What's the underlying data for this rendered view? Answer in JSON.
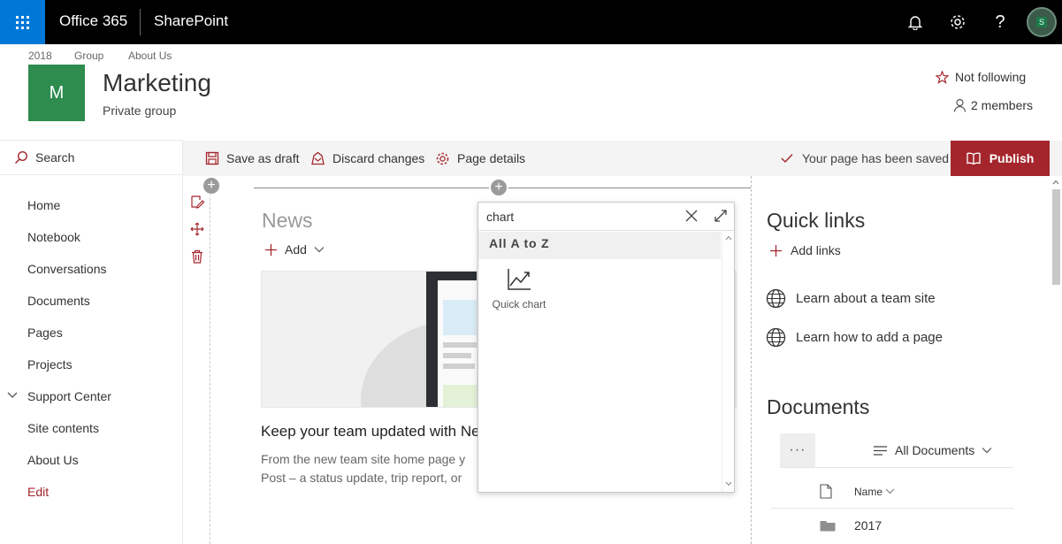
{
  "suite": {
    "app_launcher_icon": "waffle-icon",
    "brand": "Office 365",
    "app": "SharePoint",
    "avatar_text": "S"
  },
  "header": {
    "breadcrumbs": [
      "2018",
      "Group",
      "About Us"
    ],
    "logo_letter": "M",
    "logo_color": "#2d8c4e",
    "title": "Marketing",
    "subtitle": "Private group",
    "follow_label": "Not following",
    "members_label": "2 members"
  },
  "leftnav": {
    "search_label": "Search",
    "items": [
      "Home",
      "Notebook",
      "Conversations",
      "Documents",
      "Pages",
      "Projects",
      "Support Center",
      "Site contents",
      "About Us"
    ],
    "edit_label": "Edit"
  },
  "commandbar": {
    "save_draft": "Save as draft",
    "discard": "Discard changes",
    "page_details": "Page details",
    "saved_status": "Your page has been saved",
    "publish": "Publish",
    "accent": "#a4262c"
  },
  "news": {
    "title": "News",
    "add_label": "Add",
    "headline": "Keep your team updated with Ne",
    "body_lines": [
      "From the new team site home page y",
      "Post – a status update, trip report, or"
    ]
  },
  "picker": {
    "search_value": "chart",
    "category": "All A to Z",
    "items": [
      {
        "label": "Quick chart",
        "icon": "line-chart-icon"
      }
    ]
  },
  "quicklinks": {
    "title": "Quick links",
    "add_label": "Add links",
    "links": [
      "Learn about a team site",
      "Learn how to add a page"
    ]
  },
  "documents": {
    "title": "Documents",
    "more_label": "···",
    "view_label": "All Documents",
    "column_name": "Name",
    "rows": [
      "2017"
    ]
  }
}
